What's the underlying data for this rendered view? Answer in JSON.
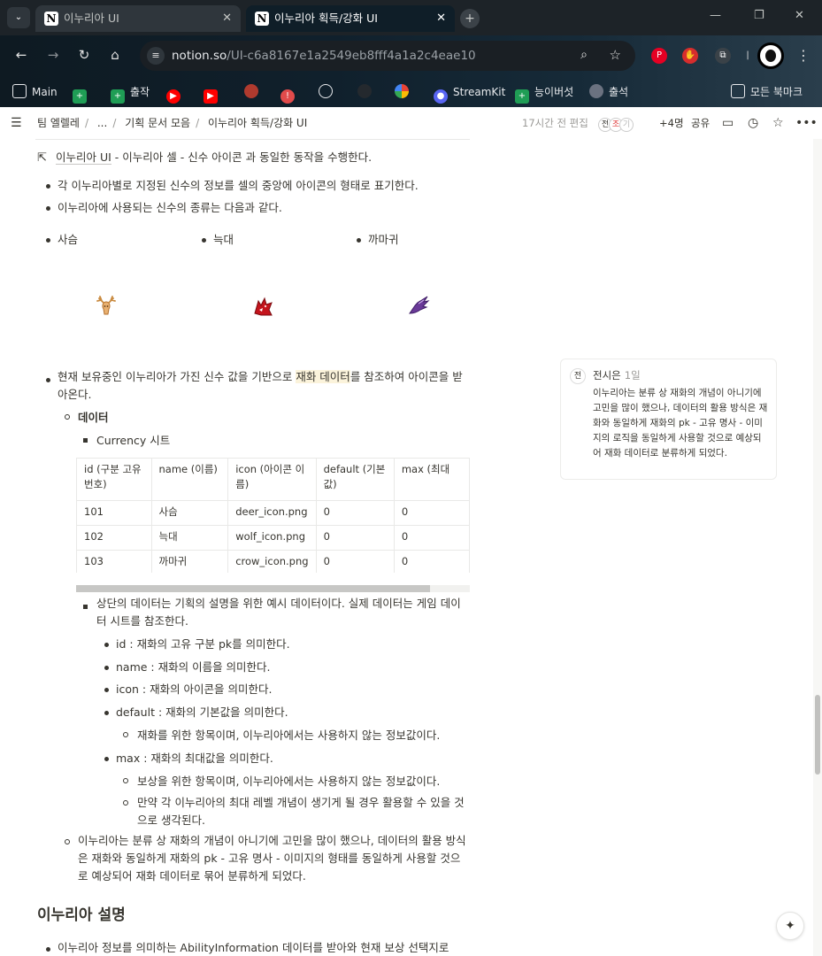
{
  "browser": {
    "tabs": [
      {
        "title": "이누리아 UI",
        "active": false
      },
      {
        "title": "이누리아 획득/강화 UI",
        "active": true
      }
    ],
    "url_domain": "notion.so",
    "url_path": "/UI-c6a8167e1a2549eb8fff4a1a2c4eae10",
    "bookmarks": [
      {
        "label": "Main",
        "icon": "folder-icon"
      },
      {
        "label": "",
        "icon": "green-plus-icon"
      },
      {
        "label": "출작",
        "icon": "green-plus-icon"
      },
      {
        "label": "",
        "icon": "youtube-music-icon"
      },
      {
        "label": "",
        "icon": "youtube-icon"
      },
      {
        "label": "",
        "icon": "avatar-icon"
      },
      {
        "label": "",
        "icon": "red-circle-icon"
      },
      {
        "label": "",
        "icon": "openai-icon"
      },
      {
        "label": "",
        "icon": "github-icon"
      },
      {
        "label": "",
        "icon": "photos-icon"
      },
      {
        "label": "StreamKit",
        "icon": "discord-icon"
      },
      {
        "label": "능이버섯",
        "icon": "green-plus-icon"
      },
      {
        "label": "출석",
        "icon": "globe-icon"
      },
      {
        "label": "모든 북마크",
        "icon": "folder-icon"
      }
    ]
  },
  "notion": {
    "breadcrumbs": [
      "팀 엘렐레",
      "...",
      "기획 문서 모음",
      "이누리아 획득/강화 UI"
    ],
    "edited": "17시간 전 편집",
    "avatars": [
      "전",
      "조",
      "기"
    ],
    "more_count": "+4명",
    "share_label": "공유"
  },
  "doc": {
    "ref_line": {
      "link": "이누리아 UI",
      "rest": " - 이누리아 셀 - 신수 아이콘 과 동일한 동작을 수행한다."
    },
    "b1": "각 이누리아별로 지정된 신수의 정보를 셀의 중앙에 아이콘의 형태로 표기한다.",
    "b2": "이누리아에 사용되는 신수의 종류는 다음과 같다.",
    "creatures": [
      "사슴",
      "늑대",
      "까마귀"
    ],
    "b3_pre": "현재 보유중인 이누리아가 가진 신수 값을 기반으로 ",
    "b3_hl": "재화 데이터",
    "b3_post": "를 참조하여 아이콘을 받아온다.",
    "data_heading": "데이터",
    "sheet_label": "Currency 시트",
    "table": {
      "headers": [
        "id (구분 고유 번호)",
        "name (이름)",
        "icon (아이콘 이름)",
        "default (기본값)",
        "max (최대"
      ],
      "rows": [
        [
          "101",
          "사슴",
          "deer_icon.png",
          "0",
          "0"
        ],
        [
          "102",
          "늑대",
          "wolf_icon.png",
          "0",
          "0"
        ],
        [
          "103",
          "까마귀",
          "crow_icon.png",
          "0",
          "0"
        ]
      ]
    },
    "note": "상단의 데이터는 기획의 설명을 위한 예시 데이터이다. 실제 데이터는 게임 데이터 시트를 참조한다.",
    "fields": [
      {
        "key": "id",
        "desc": " : 재화의 고유 구분 pk를 의미한다."
      },
      {
        "key": "name",
        "desc": " : 재화의 이름을 의미한다."
      },
      {
        "key": "icon",
        "desc": " : 재화의 아이콘을 의미한다."
      },
      {
        "key": "default",
        "desc": " : 재화의 기본값을 의미한다."
      },
      {
        "key": "max",
        "desc": " : 재화의 최대값을 의미한다."
      }
    ],
    "default_sub": "재화를 위한 항목이며, 이누리아에서는 사용하지 않는 정보값이다.",
    "max_sub1": "보상을 위한 항목이며, 이누리아에서는 사용하지 않는 정보값이다.",
    "max_sub2": "만약 각 이누리아의 최대 레벨 개념이 생기게 될 경우 활용할 수 있을 것으로 생각된다.",
    "summary": "이누리아는 분류 상 재화의 개념이 아니기에 고민을 많이 했으나, 데이터의 활용 방식은 재화와 동일하게 재화의 pk - 고유 명사 - 이미지의 형태를 동일하게 사용할 것으로 예상되어 재화 데이터로 묶어 분류하게 되었다.",
    "section_heading": "이누리아 설명",
    "last_line": "이누리아 정보를 의미하는 AbilityInformation 데이터를 받아와 현재 보상 선택지로"
  },
  "comment": {
    "avatar": "전",
    "author": "전시은",
    "time": "1일",
    "body": "이누리아는 분류 상 재화의 개념이 아니기에 고민을 많이 했으나, 데이터의 활용 방식은 재화와 동일하게 재화의 pk - 고유 명사 - 이미지의 로직을 동일하게 사용할 것으로 예상되어 재화 데이터로 분류하게 되었다."
  }
}
